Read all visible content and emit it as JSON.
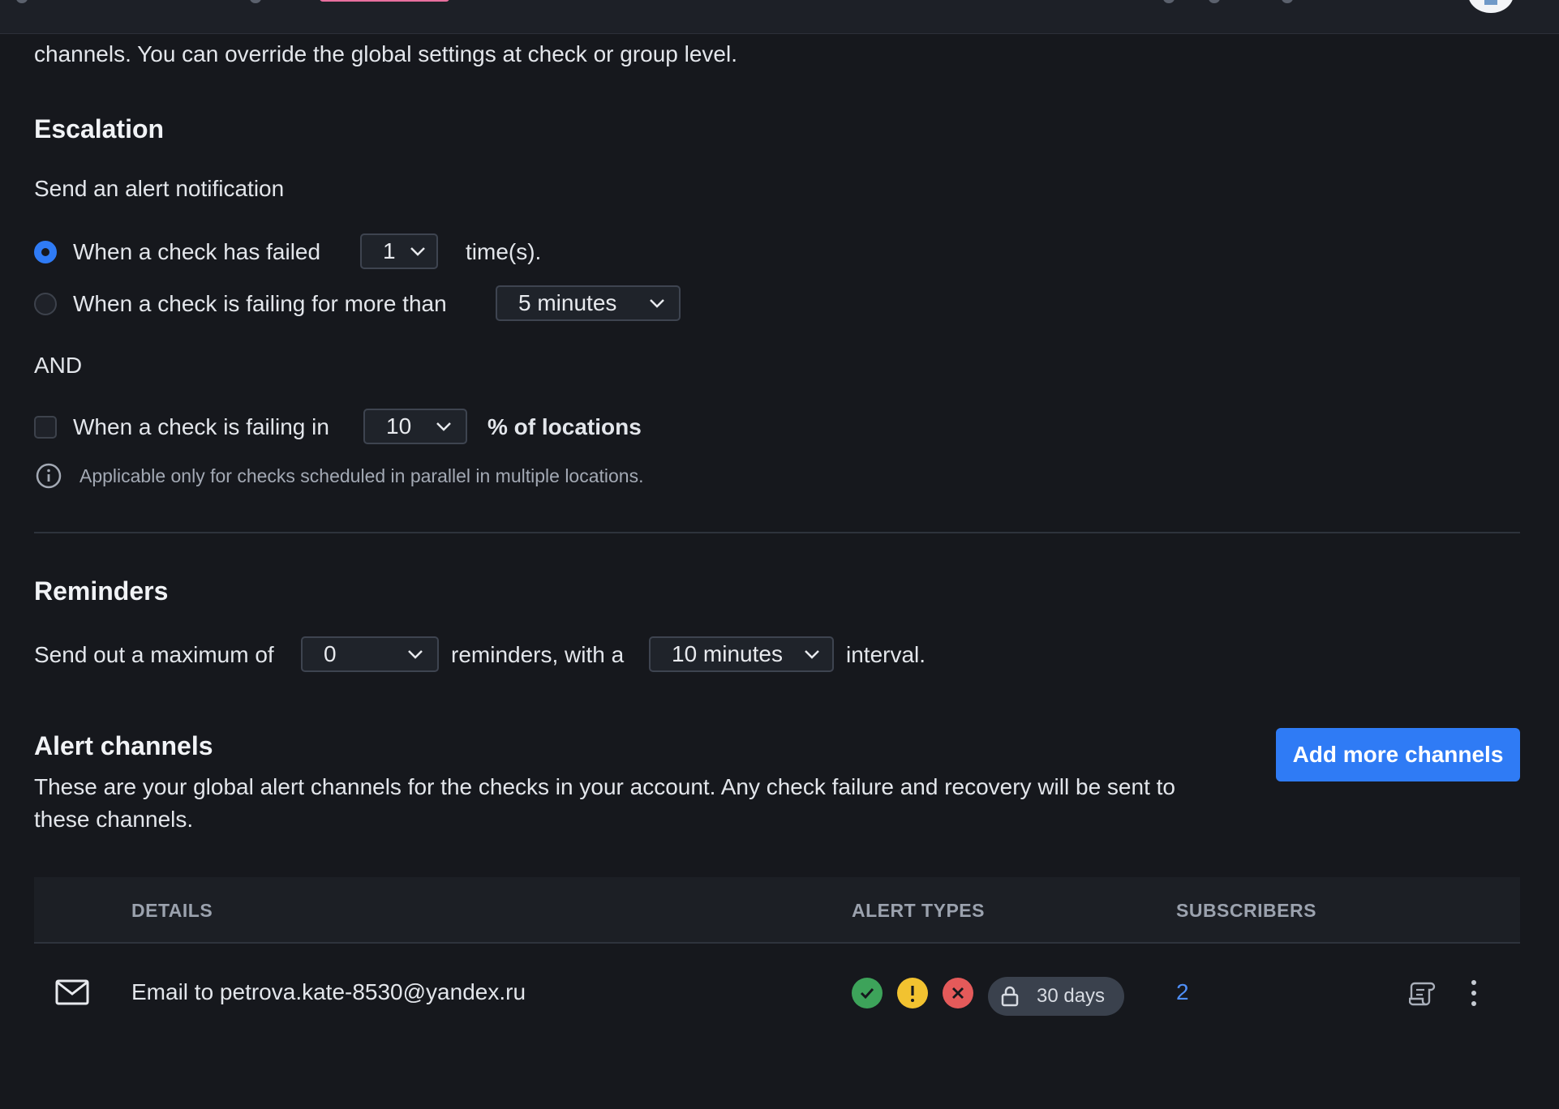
{
  "colors": {
    "background": "#16181d",
    "accent": "#2f7bf5",
    "success": "#3da35a",
    "warning": "#f2c230",
    "danger": "#e45a5a"
  },
  "intro_text": "channels. You can override the global settings at check or group level.",
  "escalation": {
    "title": "Escalation",
    "subtitle": "Send an alert notification",
    "option_failed": {
      "label": "When a check has failed",
      "select_value": "1",
      "suffix": "time(s).",
      "selected": true
    },
    "option_failing": {
      "label": "When a check is failing for more than",
      "select_value": "5 minutes",
      "selected": false
    },
    "and_label": "AND",
    "locations": {
      "label": "When a check is failing in",
      "select_value": "10",
      "suffix": "% of locations",
      "checked": false
    },
    "info_text": "Applicable only for checks scheduled in parallel in multiple locations."
  },
  "reminders": {
    "title": "Reminders",
    "prefix": "Send out a maximum of",
    "count_value": "0",
    "middle": "reminders, with a",
    "interval_value": "10 minutes",
    "suffix": "interval."
  },
  "alert_channels": {
    "title": "Alert channels",
    "description_line1": "These are your global alert channels for the checks in your account. Any check failure and recovery will be sent to",
    "description_line2": "these channels.",
    "add_button": "Add more channels",
    "table": {
      "headers": [
        "DETAILS",
        "ALERT TYPES",
        "SUBSCRIBERS"
      ],
      "rows": [
        {
          "icon": "mail-icon",
          "details": "Email to petrova.kate-8530@yandex.ru",
          "alert_types": [
            "recovery",
            "degraded",
            "failure"
          ],
          "ssl_badge": "30 days",
          "subscribers": "2"
        }
      ]
    }
  }
}
